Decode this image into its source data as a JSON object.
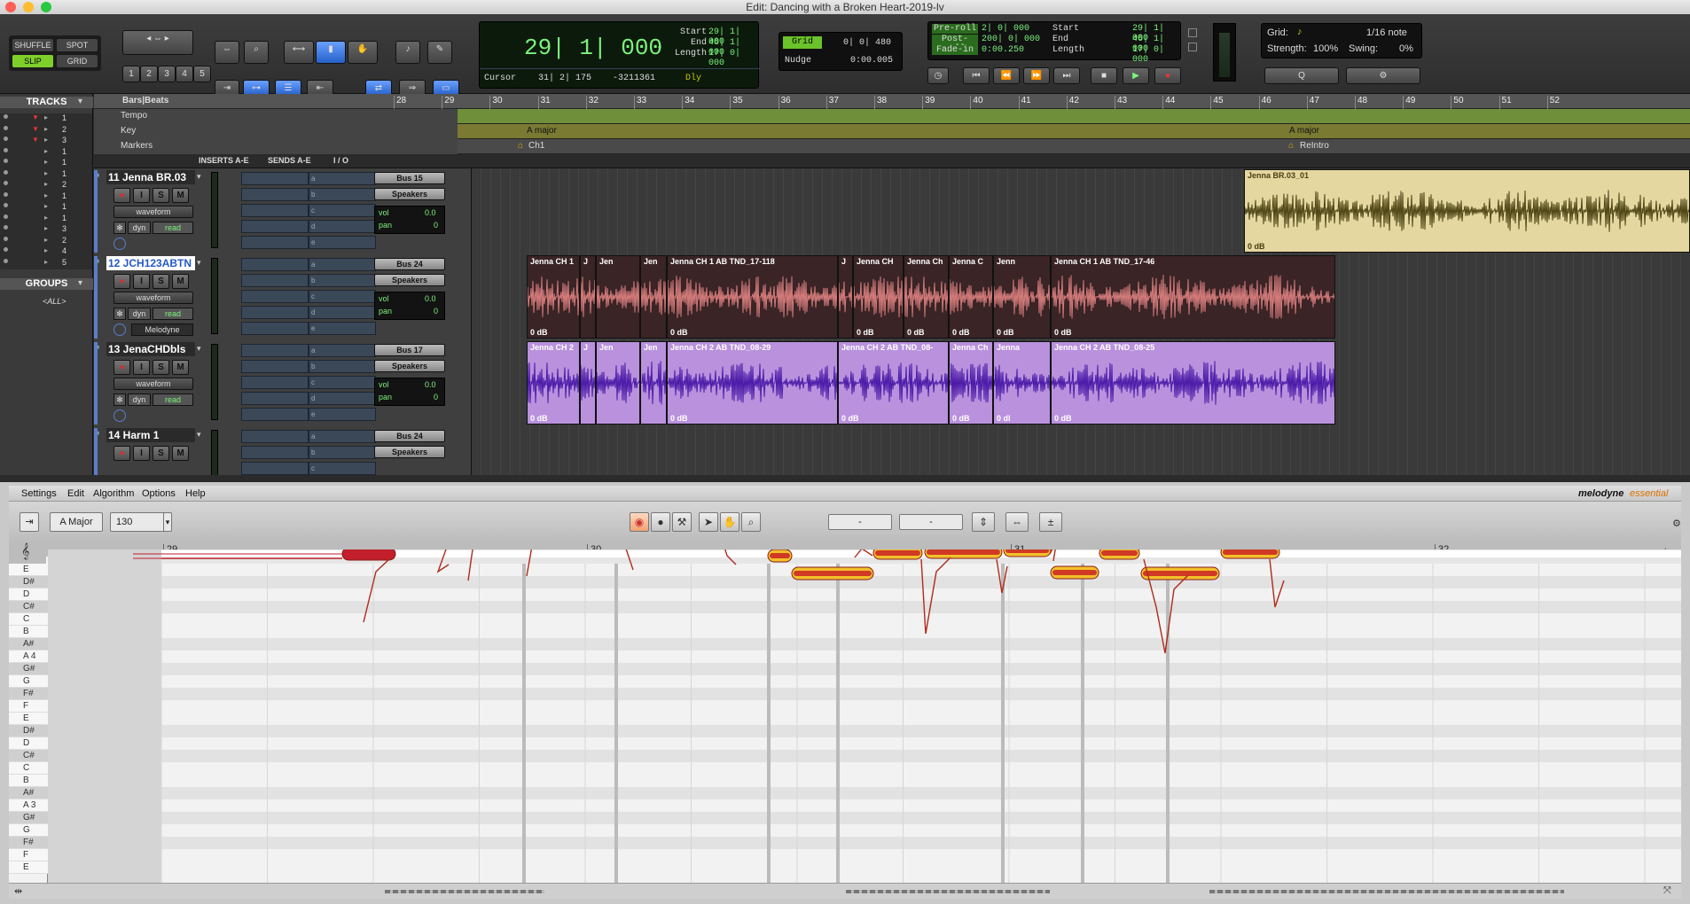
{
  "window": {
    "title": "Edit: Dancing with a Broken Heart-2019-lv"
  },
  "edit_modes": [
    "SHUFFLE",
    "SPOT",
    "SLIP",
    "GRID"
  ],
  "zoom_presets": [
    "1",
    "2",
    "3",
    "4",
    "5"
  ],
  "counter": {
    "main": "29| 1| 000",
    "start_label": "Start",
    "start": "29| 1| 000",
    "end_label": "End",
    "end": "46| 1| 000",
    "length_label": "Length",
    "length": "17| 0| 000",
    "cursor_label": "Cursor",
    "cursor": "31| 2| 175",
    "cursor_value": "-3211361",
    "dly": "Dly"
  },
  "grid_nudge": {
    "grid_label": "Grid",
    "grid_value": "0| 0| 480",
    "nudge_label": "Nudge",
    "nudge_value": "0:00.005"
  },
  "transport_lcd": {
    "preroll_label": "Pre-roll",
    "preroll": "2| 0| 000",
    "postroll_label": "Post-roll",
    "postroll": "200| 0| 000",
    "fadein_label": "Fade-in",
    "fadein": "0:00.250",
    "start_label": "Start",
    "start": "29| 1| 000",
    "end_label": "End",
    "end": "46| 1| 000",
    "length_label": "Length",
    "length": "17| 0| 000"
  },
  "grid_panel": {
    "grid_label": "Grid:",
    "grid_value": "1/16 note",
    "strength_label": "Strength:",
    "strength": "100%",
    "swing_label": "Swing:",
    "swing": "0%"
  },
  "tracks_panel": {
    "title": "TRACKS",
    "groups_title": "GROUPS",
    "all_group": "<ALL>",
    "rows": [
      "1",
      "2",
      "3",
      "1",
      "1",
      "1",
      "2",
      "1",
      "1",
      "1",
      "3",
      "2",
      "4",
      "5"
    ]
  },
  "rulers": {
    "bars_label": "Bars|Beats",
    "tempo": "Tempo",
    "key": "Key",
    "markers": "Markers",
    "bars": [
      "28",
      "29",
      "30",
      "31",
      "32",
      "33",
      "34",
      "35",
      "36",
      "37",
      "38",
      "39",
      "40",
      "41",
      "42",
      "43",
      "44",
      "45",
      "46",
      "47",
      "48",
      "49",
      "50",
      "51",
      "52"
    ],
    "key_marker_1": "A major",
    "key_marker_2": "A major",
    "marker_1": "Ch1",
    "marker_2": "ReIntro"
  },
  "column_headers": {
    "inserts": "INSERTS A-E",
    "sends": "SENDS A-E",
    "io": "I / O"
  },
  "tracks": [
    {
      "name": "11 Jenna BR.03",
      "bus": "Bus 15",
      "out": "Speakers",
      "view": "waveform",
      "dyn": "dyn",
      "auto": "read",
      "vol_label": "vol",
      "vol": "0.0",
      "pan_label": "pan",
      "pan": "0",
      "plugin": ""
    },
    {
      "name": "12 JCH123ABTN",
      "bus": "Bus 24",
      "out": "Speakers",
      "view": "waveform",
      "dyn": "dyn",
      "auto": "read",
      "vol_label": "vol",
      "vol": "0.0",
      "pan_label": "pan",
      "pan": "0",
      "plugin": "Melodyne"
    },
    {
      "name": "13 JenaCHDbls",
      "bus": "Bus 17",
      "out": "Speakers",
      "view": "waveform",
      "dyn": "dyn",
      "auto": "read",
      "vol_label": "vol",
      "vol": "0.0",
      "pan_label": "pan",
      "pan": "0",
      "plugin": ""
    },
    {
      "name": "14  Harm 1",
      "bus": "Bus 24",
      "out": "Speakers"
    }
  ],
  "send_letters": [
    "a",
    "b",
    "c",
    "d",
    "e"
  ],
  "clips": {
    "t1": [
      {
        "name": "Jenna BR.03_01",
        "gain": "0 dB"
      }
    ],
    "t2": [
      {
        "name": "Jenna CH 1",
        "gain": "0 dB"
      },
      {
        "name": "J",
        "gain": ""
      },
      {
        "name": "Jen",
        "gain": ""
      },
      {
        "name": "Jen",
        "gain": ""
      },
      {
        "name": "Jenna CH 1 AB TND_17-118",
        "gain": "0 dB"
      },
      {
        "name": "J",
        "gain": ""
      },
      {
        "name": "Jenna CH",
        "gain": "0 dB"
      },
      {
        "name": "Jenna Ch",
        "gain": "0 dB"
      },
      {
        "name": "Jenna C",
        "gain": "0 dB"
      },
      {
        "name": "Jenn",
        "gain": "0 dB"
      },
      {
        "name": "Jenna CH 1 AB TND_17-46",
        "gain": "0 dB"
      }
    ],
    "t3": [
      {
        "name": "Jenna CH 2",
        "gain": "0 dB"
      },
      {
        "name": "J",
        "gain": ""
      },
      {
        "name": "Jen",
        "gain": ""
      },
      {
        "name": "Jen",
        "gain": ""
      },
      {
        "name": "Jenna CH 2 AB TND_08-29",
        "gain": "0 dB"
      },
      {
        "name": "Jenna CH 2 AB TND_08-",
        "gain": "0 dB"
      },
      {
        "name": "Jenna Ch",
        "gain": "0 dB"
      },
      {
        "name": "Jenna",
        "gain": "0 dl"
      },
      {
        "name": "Jenna CH 2 AB TND_08-25",
        "gain": "0 dB"
      }
    ]
  },
  "melodyne": {
    "menu": [
      "Settings",
      "Edit",
      "Algorithm",
      "Options",
      "Help"
    ],
    "brand": "melodyne",
    "edition": "essential",
    "scale": "A Major",
    "tempo": "130",
    "field1": "-",
    "field2": "-",
    "ruler": [
      "29",
      "30",
      "31",
      "32"
    ],
    "pitch_keys": [
      "E",
      "D#",
      "D",
      "C#",
      "C",
      "B",
      "A#",
      "A 4",
      "G#",
      "G",
      "F#",
      "F",
      "E",
      "D#",
      "D",
      "C#",
      "C",
      "B",
      "A#",
      "A 3",
      "G#",
      "G",
      "F#",
      "F",
      "E"
    ]
  },
  "colors": {
    "accent_green": "#7cf27c",
    "track2_clip": "#3c2426",
    "track3_clip": "#b98fe0",
    "track1_clip": "#e7dca3",
    "blob": "#c2202a"
  }
}
